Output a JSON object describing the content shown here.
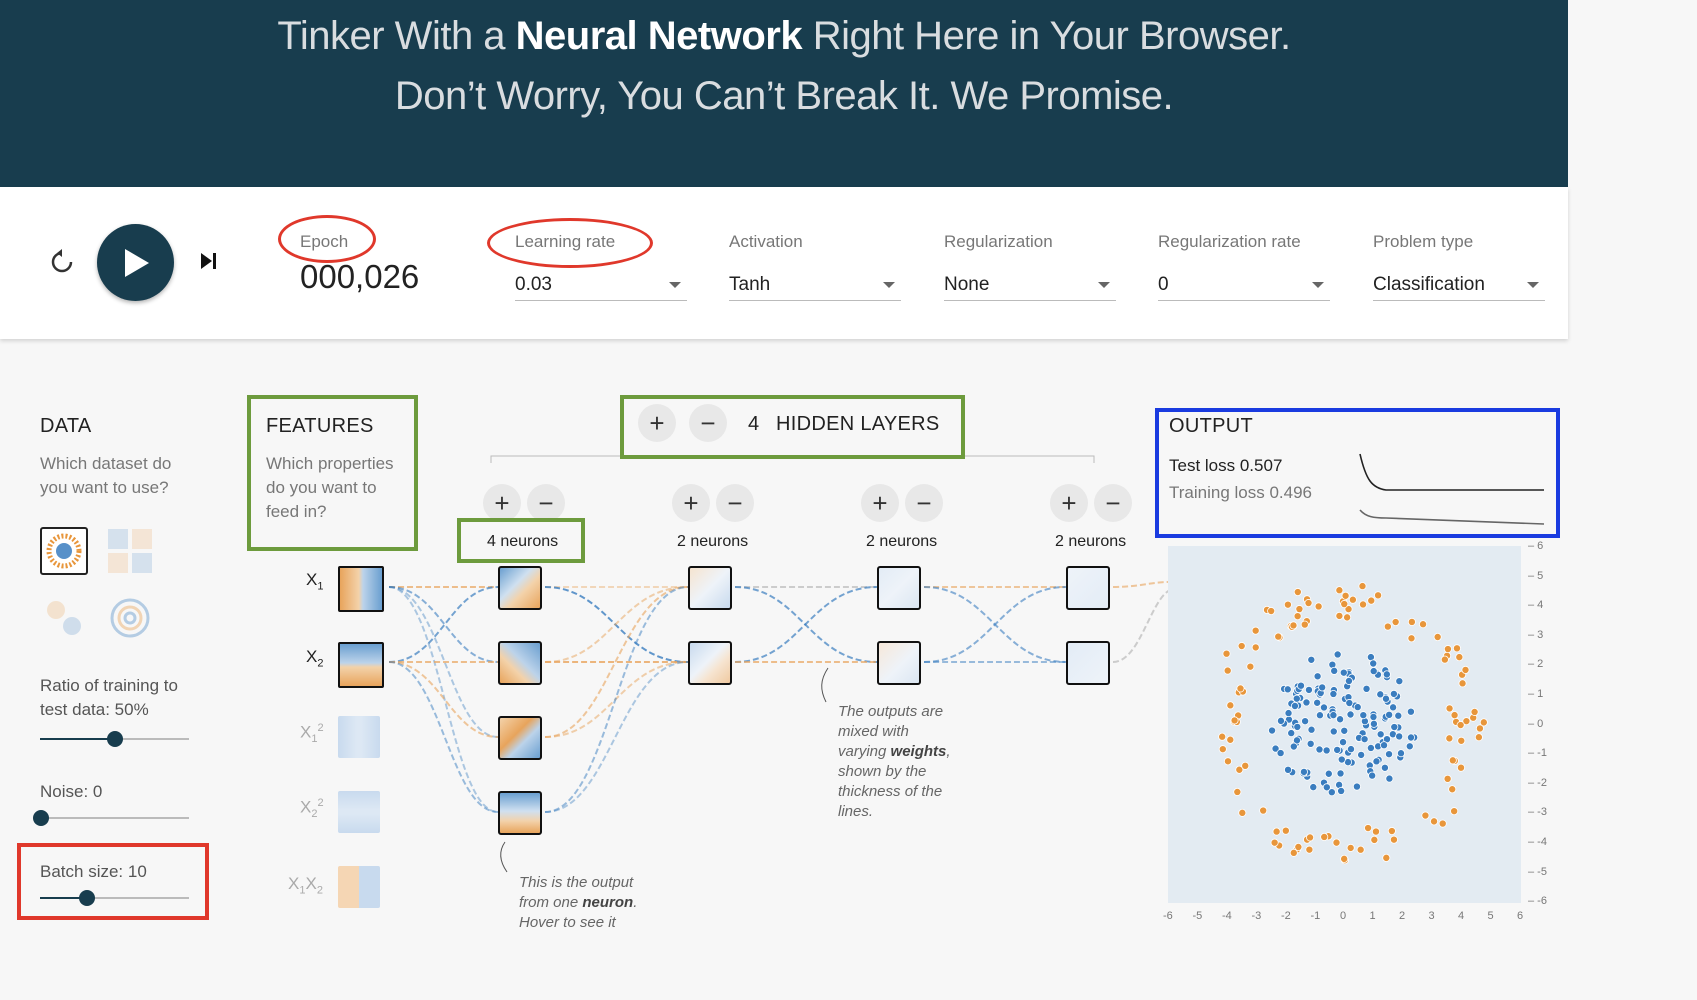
{
  "header": {
    "line1_pre": "Tinker With a ",
    "line1_bold": "Neural Network",
    "line1_post": " Right Here in Your Browser.",
    "line2": "Don’t Worry, You Can’t Break It. We Promise."
  },
  "controls": {
    "epoch_label": "Epoch",
    "epoch_value": "000,026",
    "learning_rate": {
      "label": "Learning rate",
      "value": "0.03"
    },
    "activation": {
      "label": "Activation",
      "value": "Tanh"
    },
    "regularization": {
      "label": "Regularization",
      "value": "None"
    },
    "regularization_rate": {
      "label": "Regularization rate",
      "value": "0"
    },
    "problem_type": {
      "label": "Problem type",
      "value": "Classification"
    }
  },
  "data_panel": {
    "title": "DATA",
    "question": [
      "Which dataset do",
      "you want to use?"
    ],
    "ratio_label": [
      "Ratio of training to",
      "test data:  50%"
    ],
    "ratio_value": 0.5,
    "noise_label": "Noise:  0",
    "noise_value": 0,
    "batch_label": "Batch size:  10",
    "batch_value": 0.3
  },
  "features": {
    "title": "FEATURES",
    "question": [
      "Which properties",
      "do you want to",
      "feed in?"
    ],
    "items": [
      {
        "label": "X",
        "sub": "1",
        "sup": ""
      },
      {
        "label": "X",
        "sub": "2",
        "sup": ""
      },
      {
        "label": "X",
        "sub": "1",
        "sup": "2"
      },
      {
        "label": "X",
        "sub": "2",
        "sup": "2"
      },
      {
        "label": "X",
        "sub": "1",
        "sup": "",
        "label2": "X",
        "sub2": "2"
      }
    ]
  },
  "network": {
    "add": "+",
    "remove": "−",
    "hidden_count": "4",
    "hidden_label": "HIDDEN LAYERS",
    "layers": [
      {
        "neurons_label": "4 neurons"
      },
      {
        "neurons_label": "2 neurons"
      },
      {
        "neurons_label": "2 neurons"
      },
      {
        "neurons_label": "2 neurons"
      }
    ],
    "note_weights": [
      "The outputs are",
      "mixed with",
      "varying ",
      "weights",
      ",",
      "shown by the",
      "thickness of the",
      "lines."
    ],
    "note_neuron": [
      "This is the output",
      "from one ",
      "neuron",
      ".",
      "Hover to see it"
    ]
  },
  "output": {
    "title": "OUTPUT",
    "test_loss": "Test loss 0.507",
    "training_loss": "Training loss 0.496",
    "y_ticks": [
      "6",
      "5",
      "4",
      "3",
      "2",
      "1",
      "0",
      "-1",
      "-2",
      "-3",
      "-4",
      "-5",
      "-6"
    ],
    "x_ticks": [
      "-6",
      "-5",
      "-4",
      "-3",
      "-2",
      "-1",
      "0",
      "1",
      "2",
      "3",
      "4",
      "5",
      "6"
    ]
  },
  "colors": {
    "blue": "#3a7dbf",
    "orange": "#e8963b",
    "dark": "#183d4e"
  }
}
